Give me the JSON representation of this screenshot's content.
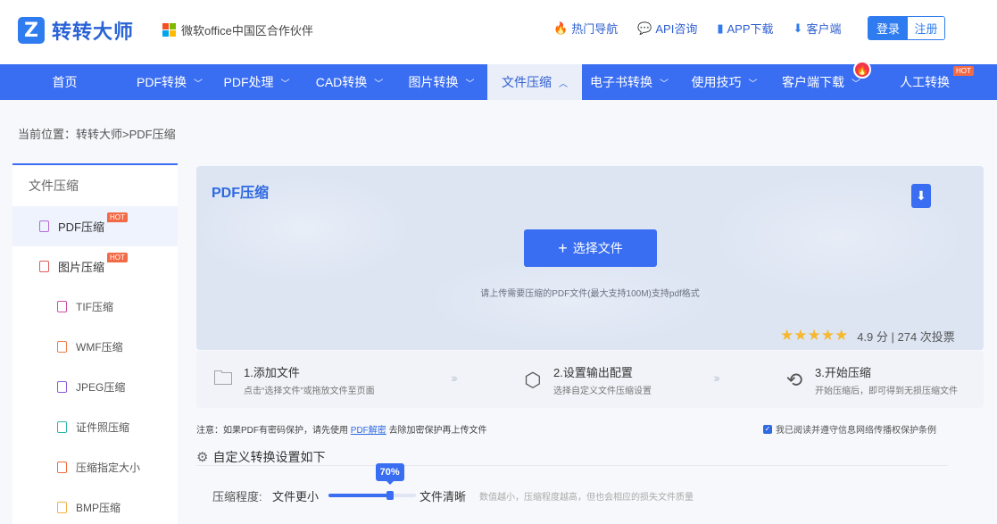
{
  "header": {
    "logo_mark": "Z",
    "brand": "转转大师",
    "partner": "微软office中国区合作伙伴",
    "links": [
      {
        "icon": "fire-icon",
        "glyph": "🔥",
        "label": "热门导航"
      },
      {
        "icon": "chat-icon",
        "glyph": "💬",
        "label": "API咨询"
      },
      {
        "icon": "phone-icon",
        "glyph": "▮",
        "label": "APP下载"
      },
      {
        "icon": "download-icon",
        "glyph": "⬇",
        "label": "客户端"
      }
    ],
    "login": "登录",
    "register": "注册"
  },
  "nav": {
    "items": [
      {
        "label": "首页"
      },
      {
        "label": "PDF转换"
      },
      {
        "label": "PDF处理"
      },
      {
        "label": "CAD转换"
      },
      {
        "label": "图片转换"
      },
      {
        "label": "文件压缩"
      },
      {
        "label": "电子书转换"
      },
      {
        "label": "使用技巧"
      },
      {
        "label": "客户端下载"
      },
      {
        "label": "人工转换"
      }
    ],
    "hot": "HOT",
    "fire_glyph": "🔥"
  },
  "breadcrumb": "当前位置：转转大师>PDF压缩",
  "sidebar": {
    "heading": "文件压缩",
    "hot": "HOT",
    "items": [
      {
        "label": "PDF压缩",
        "icon": "pdf-file-icon",
        "color": "#b06bd8"
      },
      {
        "label": "图片压缩",
        "icon": "image-file-icon",
        "color": "#e05a5a"
      },
      {
        "label": "TIF压缩",
        "icon": "tif-file-icon",
        "color": "#d04fa0"
      },
      {
        "label": "WMF压缩",
        "icon": "wmf-file-icon",
        "color": "#f07a48"
      },
      {
        "label": "JPEG压缩",
        "icon": "jpeg-file-icon",
        "color": "#8a5ad8"
      },
      {
        "label": "证件照压缩",
        "icon": "id-photo-icon",
        "color": "#2bb6a8"
      },
      {
        "label": "压缩指定大小",
        "icon": "size-file-icon",
        "color": "#f06a3a"
      },
      {
        "label": "BMP压缩",
        "icon": "bmp-file-icon",
        "color": "#f0b048"
      }
    ]
  },
  "upload": {
    "title": "PDF压缩",
    "button": "选择文件",
    "plus": "+",
    "hint": "请上传需要压缩的PDF文件(最大支持100M)支持pdf格式",
    "stars": "★★★★★",
    "rating": "4.9 分 | 274 次投票",
    "download_glyph": "⬇"
  },
  "steps": [
    {
      "icon": "folder-icon",
      "glyph": "🗀",
      "title": "1.添加文件",
      "sub": "点击“选择文件”或拖放文件至页面"
    },
    {
      "icon": "settings-icon",
      "glyph": "⬡",
      "title": "2.设置输出配置",
      "sub": "选择自定义文件压缩设置"
    },
    {
      "icon": "compress-icon",
      "glyph": "⟲",
      "title": "3.开始压缩",
      "sub": "开始压缩后，即可得到无损压缩文件"
    }
  ],
  "step_arrow": "›››",
  "note": {
    "prefix": "注意：如果PDF有密码保护，请先使用",
    "link": "PDF解密",
    "suffix": "去除加密保护再上传文件"
  },
  "agree": {
    "check": "✓",
    "label": "我已阅读并遵守信息网络传播权保护条例"
  },
  "settings": {
    "gear": "⚙",
    "title": "自定义转换设置如下",
    "label": "压缩程度:",
    "left": "文件更小",
    "right": "文件清晰",
    "value": 70,
    "value_text": "70%",
    "hint": "数值越小，压缩程度越高，但也会相应的损失文件质量"
  }
}
